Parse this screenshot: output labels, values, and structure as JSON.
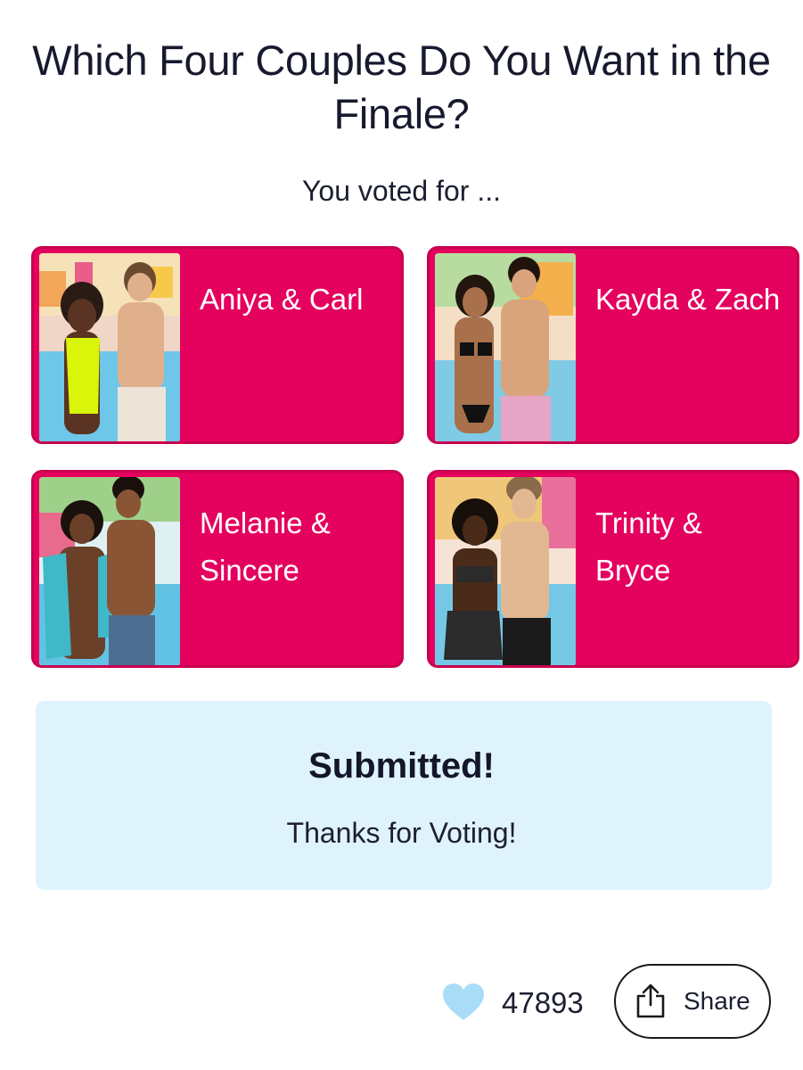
{
  "page": {
    "title": "Which Four Couples Do You Want in the Finale?",
    "subtitle": "You voted for ..."
  },
  "couples": [
    {
      "label": "Aniya & Carl",
      "photo_icon": "couple-photo"
    },
    {
      "label": "Kayda & Zach",
      "photo_icon": "couple-photo"
    },
    {
      "label": "Melanie & Sincere",
      "photo_icon": "couple-photo"
    },
    {
      "label": "Trinity & Bryce",
      "photo_icon": "couple-photo"
    }
  ],
  "status": {
    "title": "Submitted!",
    "message": "Thanks for Voting!"
  },
  "footer": {
    "like_count": "47893",
    "share_label": "Share",
    "like_icon": "heart-icon",
    "share_icon": "share-icon"
  },
  "colors": {
    "card_background": "#e4025e",
    "submitted_background": "#dff3fc",
    "heart": "#a9ddf7",
    "text": "#171a2e"
  }
}
